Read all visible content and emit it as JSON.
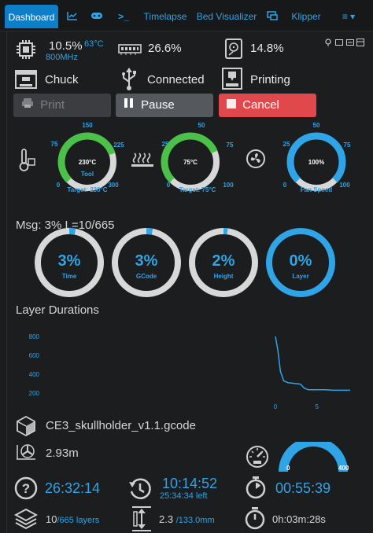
{
  "nav": {
    "tabs": [
      {
        "label": "Dashboard"
      },
      {
        "label": "Timelapse"
      },
      {
        "label": "Bed Visualizer"
      },
      {
        "label": "Klipper"
      }
    ],
    "terminal_glyph": ">_"
  },
  "stats": {
    "cpu_load": "10.5%",
    "cpu_temp": "63°C",
    "cpu_freq": "800MHz",
    "memory": "26.6%",
    "disk": "14.8%"
  },
  "status": {
    "printer": "Chuck",
    "connection": "Connected",
    "state": "Printing"
  },
  "buttons": {
    "print": "Print",
    "pause": "Pause",
    "cancel": "Cancel"
  },
  "gauges": {
    "tool": {
      "value": 230,
      "min": "0",
      "max": "300",
      "t75": "75",
      "t150": "150",
      "t225": "225",
      "value_label": "230°C",
      "name": "Tool",
      "target": "Target: 230°C",
      "fraction": 0.767
    },
    "bed": {
      "value": 75,
      "min": "0",
      "max": "100",
      "t25": "25",
      "t50": "50",
      "t75": "75",
      "value_label": "75°C",
      "name": "",
      "target": "Target: 75°C",
      "fraction": 0.75
    },
    "fan": {
      "value": 100,
      "min": "0",
      "max": "100",
      "t25": "25",
      "t50": "50",
      "t75": "75",
      "value_label": "100%",
      "name": "Fan Speed",
      "fraction": 1.0
    }
  },
  "progress": {
    "msg": "Msg: 3% L=10/665",
    "items": [
      {
        "value": "3%",
        "label": "Time",
        "fraction": 0.03
      },
      {
        "value": "3%",
        "label": "GCode",
        "fraction": 0.03
      },
      {
        "value": "2%",
        "label": "Height",
        "fraction": 0.02
      },
      {
        "value": "0%",
        "label": "Layer",
        "fraction": 1.0
      }
    ]
  },
  "layer_durations": {
    "title": "Layer Durations",
    "chart_data": {
      "type": "line",
      "y_ticks": [
        "800",
        "600",
        "400",
        "200"
      ],
      "x_ticks": [
        "0",
        "5"
      ],
      "ylim": [
        150,
        850
      ],
      "xlim": [
        0,
        9
      ],
      "x": [
        0,
        0.3,
        0.6,
        1,
        1.5,
        2,
        2.5,
        3,
        3.5,
        4,
        5,
        6,
        7,
        8,
        9
      ],
      "y": [
        800,
        650,
        430,
        330,
        310,
        305,
        300,
        295,
        250,
        235,
        235,
        235,
        230,
        230,
        230
      ]
    }
  },
  "file": {
    "name": "CE3_skullholder_v1.1.gcode",
    "filament": "2.93m"
  },
  "speed_gauge": {
    "max": "400",
    "min": "0"
  },
  "times": {
    "estimate": "26:32:14",
    "eta": "10:14:52",
    "left": "25:34:34 left",
    "elapsed": "00:55:39",
    "layers": "10",
    "layers_total": "/665 layers",
    "height": "2.3",
    "height_total": "/133.0mm",
    "layer_time": "0h:03m:28s"
  },
  "colors": {
    "accent_blue": "#2fa4e7",
    "green": "#4cc14a",
    "cancel_red": "#e0484c",
    "ring_gray": "#d8d8d8"
  }
}
